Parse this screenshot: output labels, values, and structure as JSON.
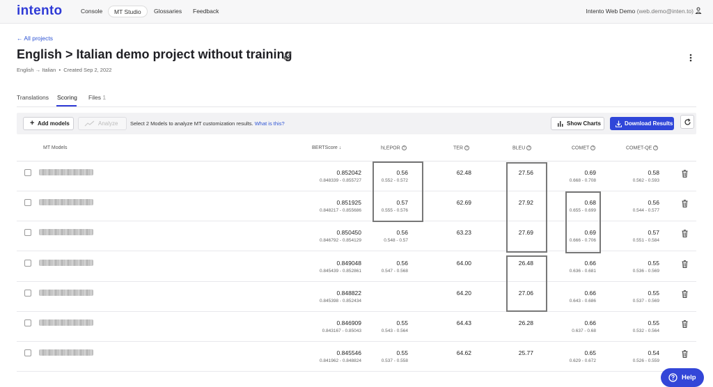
{
  "nav": {
    "logo": "intento",
    "links": [
      "Console",
      "MT Studio",
      "Glossaries",
      "Feedback"
    ],
    "user_name": "Intento Web Demo",
    "user_email": "(web.demo@inten.to)"
  },
  "header": {
    "back": "All projects",
    "title": "English > Italian demo project without training",
    "lang_pair": "English → Italian",
    "created": "Created Sep 2, 2022"
  },
  "tabs": [
    {
      "label": "Translations"
    },
    {
      "label": "Scoring"
    },
    {
      "label": "Files",
      "count": "1"
    }
  ],
  "toolbar": {
    "add_models": "Add models",
    "analyze": "Analyze",
    "hint": "Select 2 Models to analyze MT customization results.",
    "hint_link": "What is this?",
    "show_charts": "Show Charts",
    "download": "Download Results"
  },
  "columns": {
    "models": "MT Models",
    "bertscore": "BERTScore",
    "hlepor": "hLEPOR",
    "ter": "TER",
    "bleu": "BLEU",
    "comet": "COMET",
    "cometqe": "COMET-QE"
  },
  "rows": [
    {
      "bert": "0.852042",
      "bert_r": "0.848339 - 0.855727",
      "hlepor": "0.56",
      "hlepor_r": "0.552 - 0.572",
      "ter": "62.48",
      "bleu": "27.56",
      "comet": "0.69",
      "comet_r": "0.668 - 0.708",
      "qe": "0.58",
      "qe_r": "0.562 - 0.593"
    },
    {
      "bert": "0.851925",
      "bert_r": "0.848217 - 0.855686",
      "hlepor": "0.57",
      "hlepor_r": "0.555 - 0.576",
      "ter": "62.69",
      "bleu": "27.92",
      "comet": "0.68",
      "comet_r": "0.655 - 0.699",
      "qe": "0.56",
      "qe_r": "0.544 - 0.577"
    },
    {
      "bert": "0.850450",
      "bert_r": "0.846792 - 0.854129",
      "hlepor": "0.56",
      "hlepor_r": "0.548 - 0.57",
      "ter": "63.23",
      "bleu": "27.69",
      "comet": "0.69",
      "comet_r": "0.666 - 0.706",
      "qe": "0.57",
      "qe_r": "0.551 - 0.584"
    },
    {
      "bert": "0.849048",
      "bert_r": "0.845439 - 0.852861",
      "hlepor": "0.56",
      "hlepor_r": "0.547 - 0.568",
      "ter": "64.00",
      "bleu": "26.48",
      "comet": "0.66",
      "comet_r": "0.636 - 0.681",
      "qe": "0.55",
      "qe_r": "0.536 - 0.569"
    },
    {
      "bert": "0.848822",
      "bert_r": "0.845398 - 0.852434",
      "hlepor": "",
      "hlepor_r": "",
      "ter": "64.20",
      "bleu": "27.06",
      "comet": "0.66",
      "comet_r": "0.643 - 0.686",
      "qe": "0.55",
      "qe_r": "0.537 - 0.569"
    },
    {
      "bert": "0.846909",
      "bert_r": "0.843167 - 0.85043",
      "hlepor": "0.55",
      "hlepor_r": "0.543 - 0.564",
      "ter": "64.43",
      "bleu": "26.28",
      "comet": "0.66",
      "comet_r": "0.637 - 0.68",
      "qe": "0.55",
      "qe_r": "0.532 - 0.564"
    },
    {
      "bert": "0.845546",
      "bert_r": "0.841962 - 0.848824",
      "hlepor": "0.55",
      "hlepor_r": "0.537 - 0.558",
      "ter": "64.62",
      "bleu": "25.77",
      "comet": "0.65",
      "comet_r": "0.629 - 0.672",
      "qe": "0.54",
      "qe_r": "0.526 - 0.559"
    }
  ],
  "help": "Help",
  "colors": {
    "accent": "#2f3bd6",
    "primary_button": "#2f46d9",
    "highlight_box": "#777777"
  }
}
